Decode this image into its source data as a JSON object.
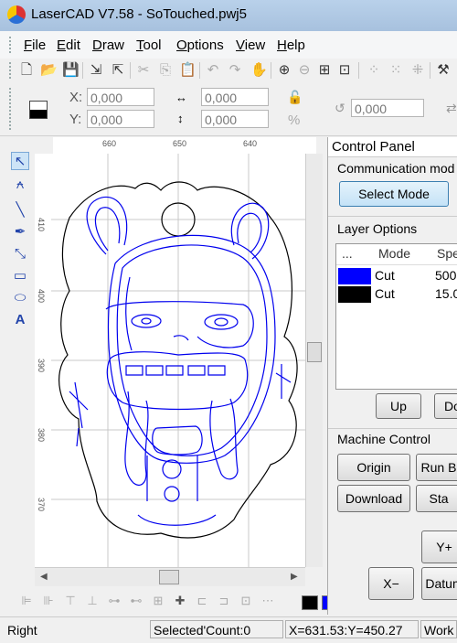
{
  "window": {
    "title": "LaserCAD V7.58 - SoTouched.pwj5"
  },
  "menu": [
    "File",
    "Edit",
    "Draw",
    "Tool",
    "Options",
    "View",
    "Help"
  ],
  "coords": {
    "x_label": "X:",
    "y_label": "Y:",
    "x_value": "0,000",
    "y_value": "0,000",
    "w_value": "0,000",
    "h_value": "0,000",
    "rotate_value": "0,000",
    "percent": "%"
  },
  "rulers": {
    "top": [
      "660",
      "650",
      "640"
    ],
    "left": [
      "410",
      "400",
      "390",
      "380",
      "370"
    ]
  },
  "panel": {
    "title": "Control Panel",
    "communication_mode": "Communication mod",
    "select_mode": "Select Mode",
    "layer_options": "Layer Options",
    "columns": [
      "...",
      "Mode",
      "Spe"
    ],
    "layers": [
      {
        "color": "#0000ff",
        "mode": "Cut",
        "speed": "500"
      },
      {
        "color": "#000000",
        "mode": "Cut",
        "speed": "15.0"
      }
    ],
    "up": "Up",
    "down": "Do",
    "machine_control": "Machine Control",
    "origin": "Origin",
    "run": "Run B",
    "download": "Download",
    "start": "Sta",
    "yplus": "Y+",
    "xminus": "X−",
    "datum": "Datum"
  },
  "palette": [
    "#000000",
    "#0000ff",
    "#ff0000",
    "#00ff00",
    "#ff99cc",
    "#ffff00",
    "#00ffff",
    "#cc6600"
  ],
  "status": {
    "mode": "Right",
    "selected": "Selected'Count:0",
    "position": "X=631.53:Y=450.27",
    "work": "Work"
  }
}
